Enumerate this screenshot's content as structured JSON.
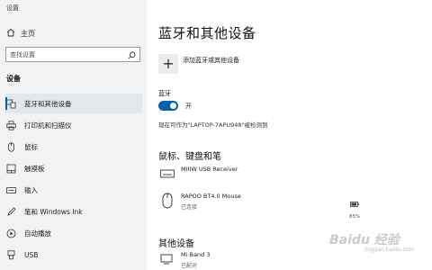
{
  "window": {
    "title": "设置"
  },
  "sidebar": {
    "home_label": "主页",
    "search_placeholder": "查找设置",
    "section_label": "设备",
    "items": [
      {
        "label": "蓝牙和其他设备",
        "icon": "bluetooth-devices-icon",
        "active": true
      },
      {
        "label": "打印机和扫描仪",
        "icon": "printer-icon"
      },
      {
        "label": "鼠标",
        "icon": "mouse-icon"
      },
      {
        "label": "触摸板",
        "icon": "touchpad-icon"
      },
      {
        "label": "输入",
        "icon": "keyboard-icon"
      },
      {
        "label": "笔和 Windows Ink",
        "icon": "pen-icon"
      },
      {
        "label": "自动播放",
        "icon": "autoplay-icon"
      },
      {
        "label": "USB",
        "icon": "usb-icon"
      }
    ]
  },
  "main": {
    "title": "蓝牙和其他设备",
    "add_device_label": "添加蓝牙或其他设备",
    "bluetooth_label": "蓝牙",
    "toggle_state": "开",
    "discoverable_text": "现在可作为\"LAPTOP-7APU948\"被检测到",
    "mouse_section": {
      "title": "鼠标、键盘和笔",
      "devices": [
        {
          "name": "MIIIW USB Receiver",
          "status": "",
          "icon": "keyboard-device-icon"
        },
        {
          "name": "RAPOO BT4.0 Mouse",
          "status": "已连接",
          "icon": "mouse-device-icon",
          "battery": "85%"
        }
      ]
    },
    "other_section": {
      "title": "其他设备",
      "devices": [
        {
          "name": "Mi Band 3",
          "status": "已配对",
          "icon": "band-device-icon"
        }
      ]
    }
  },
  "watermark": {
    "text": "Baidu 经验",
    "sub": "jingyan.baidu.com"
  },
  "colors": {
    "accent": "#0063b1",
    "sidebar_bg": "#f0f2f4"
  }
}
